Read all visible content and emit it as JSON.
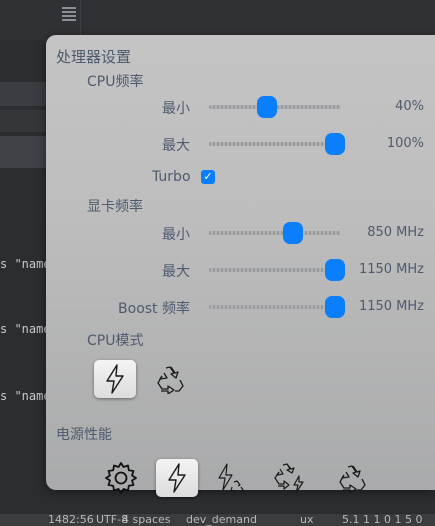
{
  "editor": {
    "code_lines": [
      "s \"name",
      "s \"name",
      "s \"name"
    ],
    "status": {
      "position": "1482:56",
      "encoding": "UTF-8",
      "indent": "4 spaces",
      "branch": "dev_demand",
      "extra": "ux",
      "tail": "5.1 1 1 0 1 5 0"
    }
  },
  "panel": {
    "title": "处理器设置",
    "cpu_freq": {
      "title": "CPU频率",
      "min_label": "最小",
      "min_value": "40%",
      "min_level": 0.4,
      "max_label": "最大",
      "max_value": "100%",
      "max_level": 1.0,
      "turbo_label": "Turbo",
      "turbo_checked": true
    },
    "gpu_freq": {
      "title": "显卡频率",
      "min_label": "最小",
      "min_value": "850 MHz",
      "min_level": 0.63,
      "max_label": "最大",
      "max_value": "1150 MHz",
      "max_level": 1.0,
      "boost_label": "Boost 频率",
      "boost_value": "1150 MHz",
      "boost_level": 1.0
    },
    "cpu_mode": {
      "title": "CPU模式",
      "options": [
        "lightning-icon",
        "recycle-icon"
      ],
      "selected": 0
    },
    "power": {
      "title": "电源性能",
      "options": [
        "gear-icon",
        "lightning-icon",
        "lightning-recycle-icon",
        "recycle-lightning-icon",
        "recycle-icon"
      ],
      "selected": 1
    }
  },
  "colors": {
    "accent": "#0b7ffb",
    "label": "#4e5a6e",
    "panel_bg": "#c0c0c0",
    "editor_bg": "#2b2d30"
  }
}
